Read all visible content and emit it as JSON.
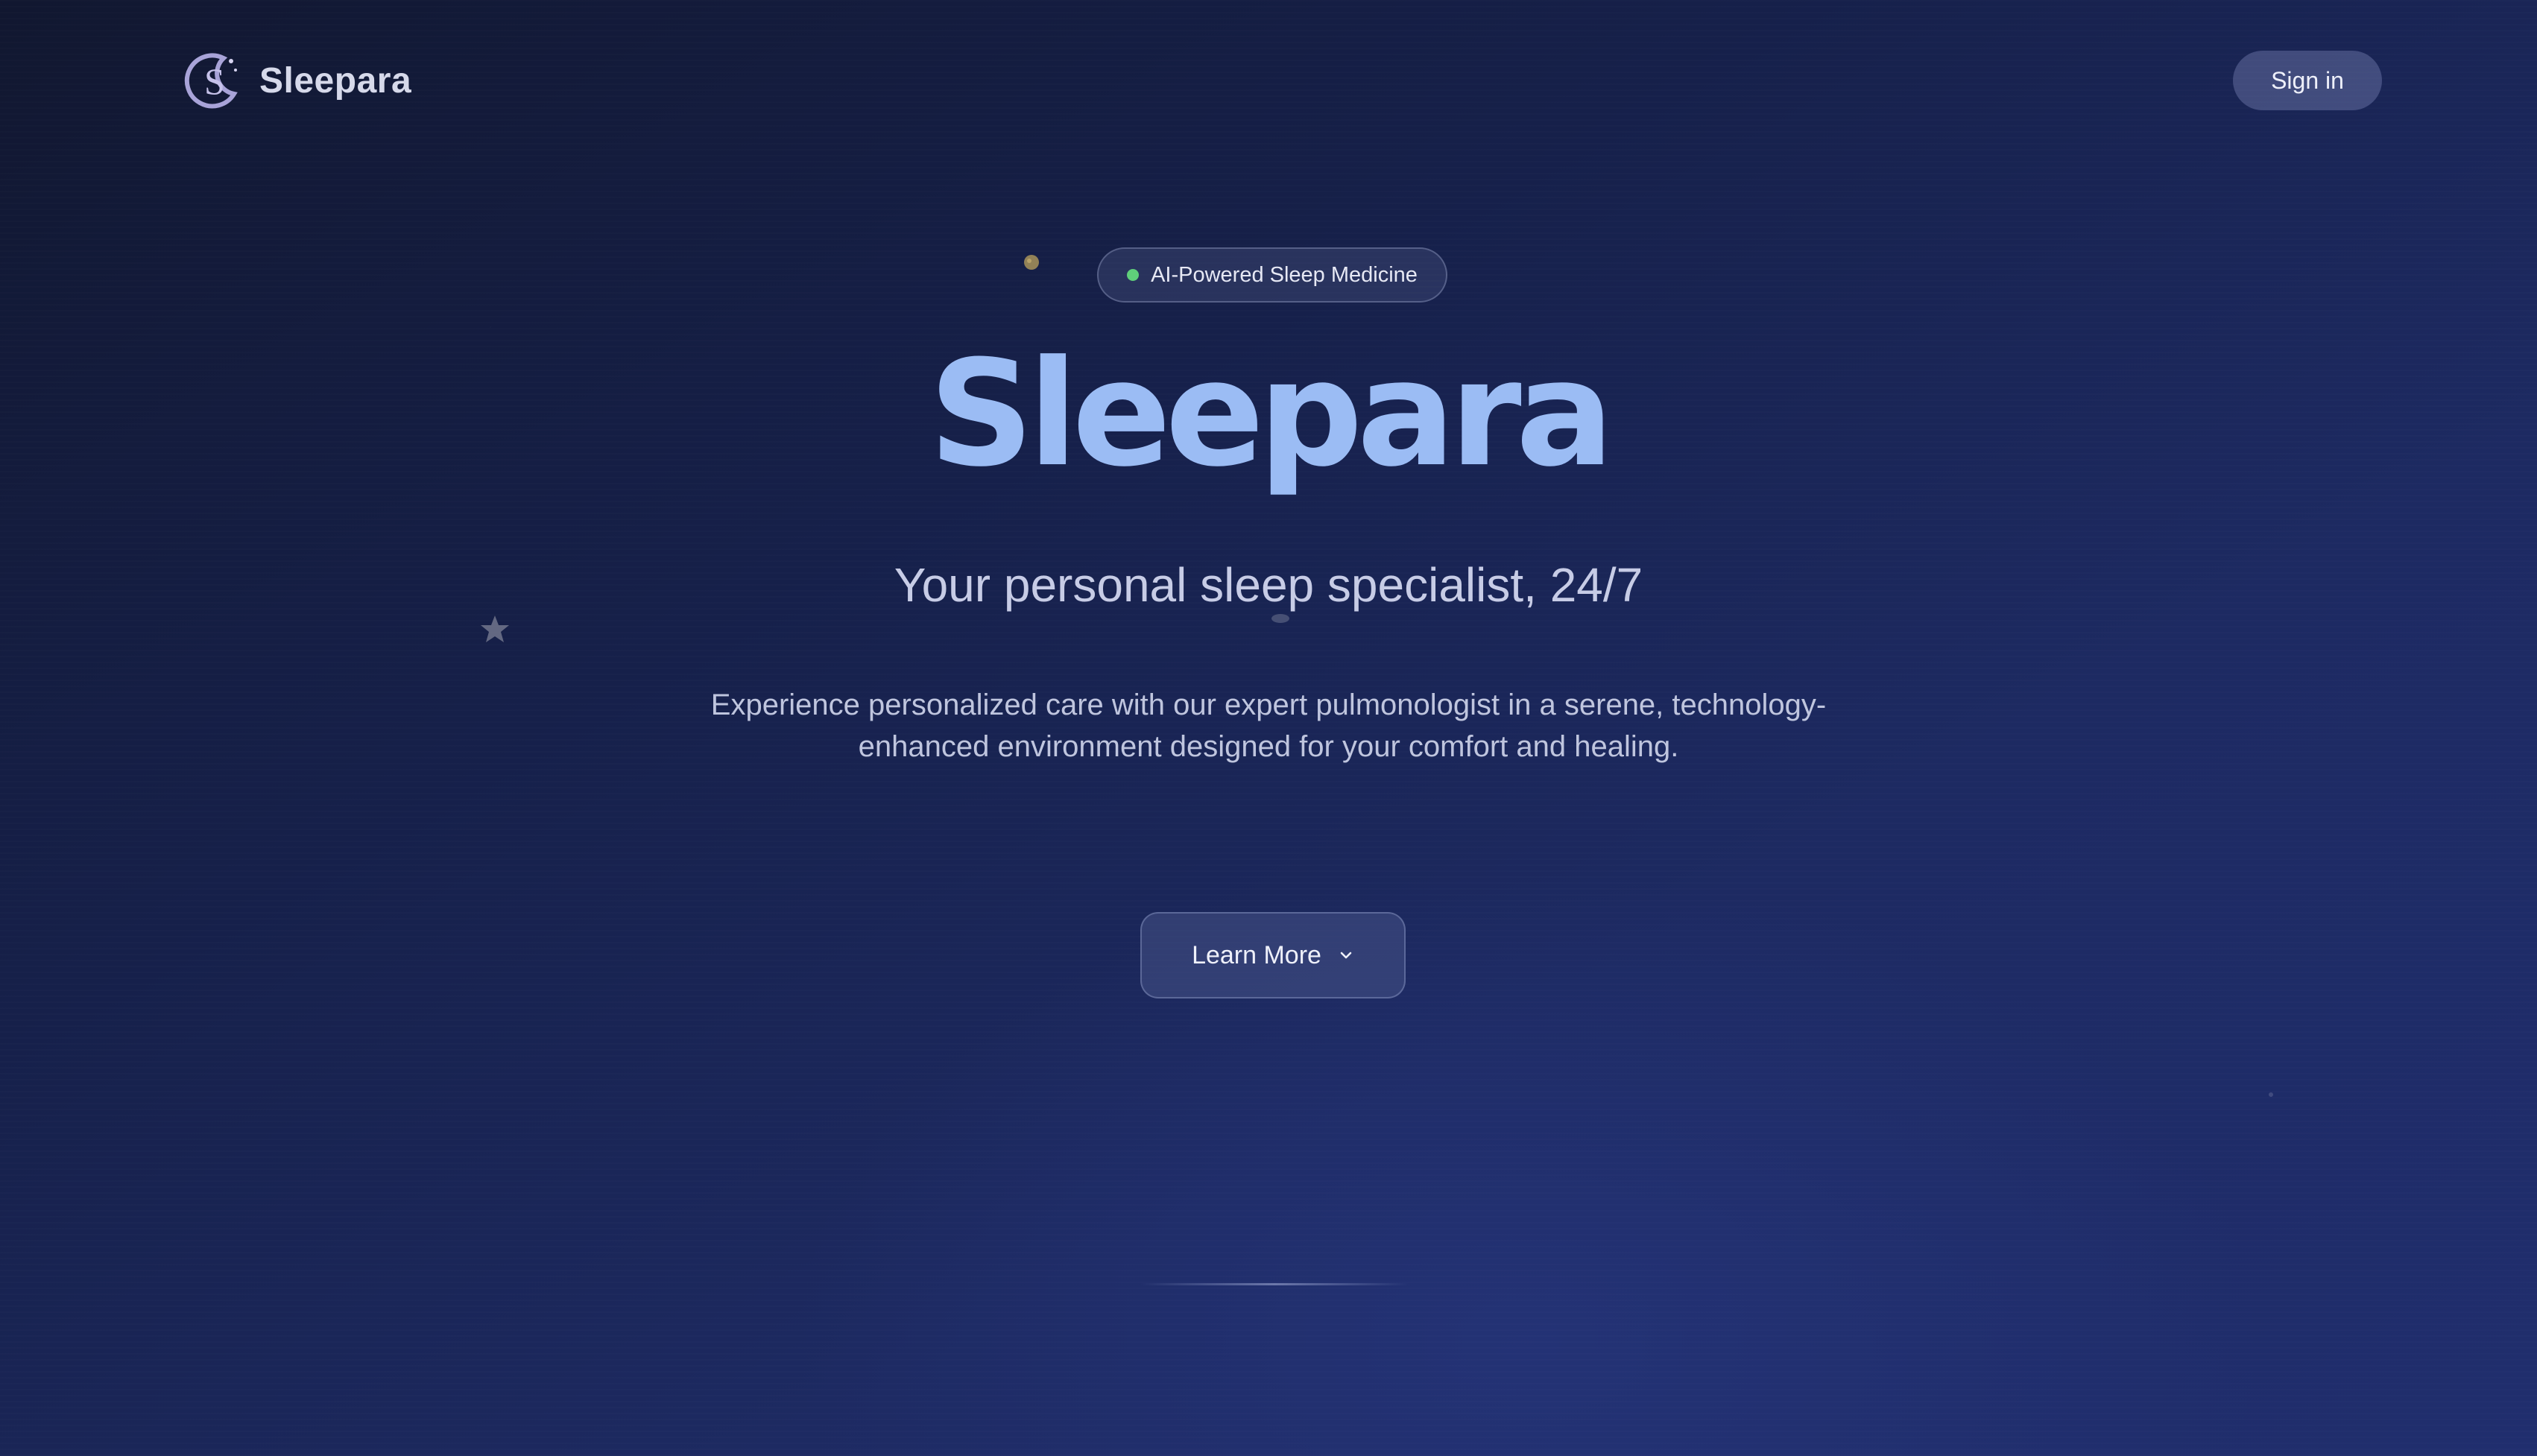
{
  "header": {
    "brand_name": "Sleepara",
    "sign_in_label": "Sign in"
  },
  "hero": {
    "badge_text": "AI-Powered Sleep Medicine",
    "title": "Sleepara",
    "subtitle": "Your personal sleep specialist, 24/7",
    "description": "Experience personalized care with our expert pulmonologist in a serene, technology-enhanced environment designed for your comfort and healing.",
    "cta_label": "Learn More"
  },
  "icons": {
    "logo": "moon-s-logo-icon",
    "cta": "chevron-down-icon",
    "decorations": [
      "planet-icon",
      "crescent-moon-icon",
      "star-icon"
    ]
  },
  "colors": {
    "background": "#1b2452",
    "title": "#9bbcf4",
    "badge_dot": "#5fce7a",
    "logo": "#a8a3d8"
  }
}
